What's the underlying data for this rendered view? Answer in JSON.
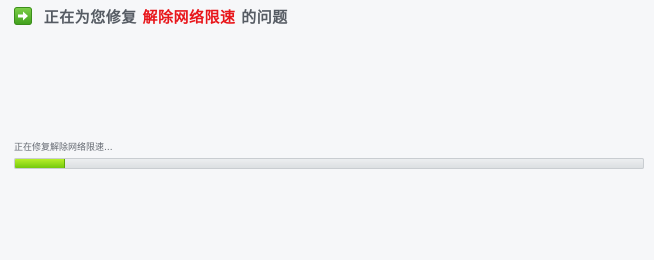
{
  "header": {
    "icon": "arrow-right-icon",
    "title_prefix": "正在为您修复",
    "title_highlight": "解除网络限速",
    "title_suffix": "的问题",
    "highlight_color": "#e8161b"
  },
  "progress": {
    "label": "正在修复解除网络限速...",
    "percent": 8,
    "fill_color": "#8fdb16"
  }
}
